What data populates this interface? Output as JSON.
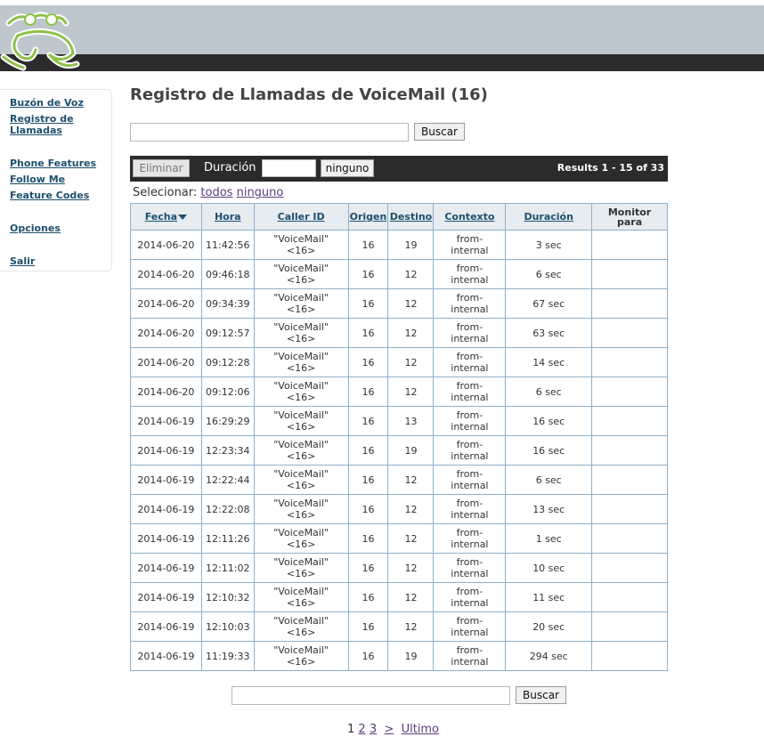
{
  "sidebar": {
    "items": [
      {
        "label": "Buzón de Voz"
      },
      {
        "label": "Registro de Llamadas"
      },
      {
        "label": "Phone Features"
      },
      {
        "label": "Follow Me"
      },
      {
        "label": "Feature Codes"
      },
      {
        "label": "Opciones"
      },
      {
        "label": "Salir"
      }
    ]
  },
  "page": {
    "title": "Registro de Llamadas de VoiceMail (16)"
  },
  "search_top": {
    "value": "",
    "button": "Buscar"
  },
  "toolbar": {
    "delete_label": "Eliminar",
    "duration_label": "Duración",
    "duration_value": "",
    "duration_select": "ninguno",
    "results": "Results 1 - 15 of 33"
  },
  "select_row": {
    "label": "Selecionar:",
    "all": "todos",
    "none": "ninguno"
  },
  "table": {
    "headers": [
      "Fecha",
      "Hora",
      "Caller ID",
      "Origen",
      "Destino",
      "Contexto",
      "Duración",
      "Monitor para"
    ],
    "rows": [
      {
        "date": "2014-06-20",
        "time": "11:42:56",
        "cid1": "\"VoiceMail\"",
        "cid2": "<16>",
        "src": "16",
        "dst": "19",
        "ctx1": "from-",
        "ctx2": "internal",
        "dur": "3 sec",
        "mon": ""
      },
      {
        "date": "2014-06-20",
        "time": "09:46:18",
        "cid1": "\"VoiceMail\"",
        "cid2": "<16>",
        "src": "16",
        "dst": "12",
        "ctx1": "from-",
        "ctx2": "internal",
        "dur": "6 sec",
        "mon": ""
      },
      {
        "date": "2014-06-20",
        "time": "09:34:39",
        "cid1": "\"VoiceMail\"",
        "cid2": "<16>",
        "src": "16",
        "dst": "12",
        "ctx1": "from-",
        "ctx2": "internal",
        "dur": "67 sec",
        "mon": ""
      },
      {
        "date": "2014-06-20",
        "time": "09:12:57",
        "cid1": "\"VoiceMail\"",
        "cid2": "<16>",
        "src": "16",
        "dst": "12",
        "ctx1": "from-",
        "ctx2": "internal",
        "dur": "63 sec",
        "mon": ""
      },
      {
        "date": "2014-06-20",
        "time": "09:12:28",
        "cid1": "\"VoiceMail\"",
        "cid2": "<16>",
        "src": "16",
        "dst": "12",
        "ctx1": "from-",
        "ctx2": "internal",
        "dur": "14 sec",
        "mon": ""
      },
      {
        "date": "2014-06-20",
        "time": "09:12:06",
        "cid1": "\"VoiceMail\"",
        "cid2": "<16>",
        "src": "16",
        "dst": "12",
        "ctx1": "from-",
        "ctx2": "internal",
        "dur": "6 sec",
        "mon": ""
      },
      {
        "date": "2014-06-19",
        "time": "16:29:29",
        "cid1": "\"VoiceMail\"",
        "cid2": "<16>",
        "src": "16",
        "dst": "13",
        "ctx1": "from-",
        "ctx2": "internal",
        "dur": "16 sec",
        "mon": ""
      },
      {
        "date": "2014-06-19",
        "time": "12:23:34",
        "cid1": "\"VoiceMail\"",
        "cid2": "<16>",
        "src": "16",
        "dst": "19",
        "ctx1": "from-",
        "ctx2": "internal",
        "dur": "16 sec",
        "mon": ""
      },
      {
        "date": "2014-06-19",
        "time": "12:22:44",
        "cid1": "\"VoiceMail\"",
        "cid2": "<16>",
        "src": "16",
        "dst": "12",
        "ctx1": "from-",
        "ctx2": "internal",
        "dur": "6 sec",
        "mon": ""
      },
      {
        "date": "2014-06-19",
        "time": "12:22:08",
        "cid1": "\"VoiceMail\"",
        "cid2": "<16>",
        "src": "16",
        "dst": "12",
        "ctx1": "from-",
        "ctx2": "internal",
        "dur": "13 sec",
        "mon": ""
      },
      {
        "date": "2014-06-19",
        "time": "12:11:26",
        "cid1": "\"VoiceMail\"",
        "cid2": "<16>",
        "src": "16",
        "dst": "12",
        "ctx1": "from-",
        "ctx2": "internal",
        "dur": "1 sec",
        "mon": ""
      },
      {
        "date": "2014-06-19",
        "time": "12:11:02",
        "cid1": "\"VoiceMail\"",
        "cid2": "<16>",
        "src": "16",
        "dst": "12",
        "ctx1": "from-",
        "ctx2": "internal",
        "dur": "10 sec",
        "mon": ""
      },
      {
        "date": "2014-06-19",
        "time": "12:10:32",
        "cid1": "\"VoiceMail\"",
        "cid2": "<16>",
        "src": "16",
        "dst": "12",
        "ctx1": "from-",
        "ctx2": "internal",
        "dur": "11 sec",
        "mon": ""
      },
      {
        "date": "2014-06-19",
        "time": "12:10:03",
        "cid1": "\"VoiceMail\"",
        "cid2": "<16>",
        "src": "16",
        "dst": "12",
        "ctx1": "from-",
        "ctx2": "internal",
        "dur": "20 sec",
        "mon": ""
      },
      {
        "date": "2014-06-19",
        "time": "11:19:33",
        "cid1": "\"VoiceMail\"",
        "cid2": "<16>",
        "src": "16",
        "dst": "19",
        "ctx1": "from-",
        "ctx2": "internal",
        "dur": "294 sec",
        "mon": ""
      }
    ]
  },
  "search_bottom": {
    "value": "",
    "button": "Buscar"
  },
  "pager": {
    "current": "1",
    "pages": [
      "2",
      "3"
    ],
    "next": ">",
    "last": "Ultimo"
  },
  "colors": {
    "header_band": "#bfc7ce",
    "dark_bar": "#2b2b2b",
    "link": "#1d4f6e",
    "frog": "#8dc24a"
  },
  "icons": {
    "logo": "frog-logo-icon",
    "sort": "sort-desc-icon"
  }
}
